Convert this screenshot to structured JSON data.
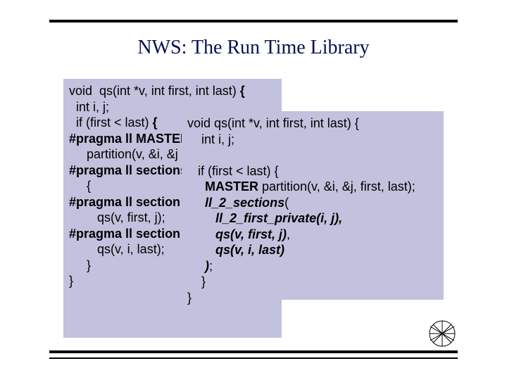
{
  "title": "NWS: The Run Time Library",
  "code_left": {
    "l1a": "void  qs(int *v, int first, int last) ",
    "l1b": "{",
    "l2": "  int i, j;",
    "l3a": "  if (first < last) ",
    "l3b": "{",
    "l4": "#pragma ll MASTER",
    "l5": "     partition(v, &i, &j first, last);",
    "l6": "#pragma ll sections firstprivate(i,j)",
    "l7": "     {",
    "l8": "#pragma ll section",
    "l9": "        qs(v, first, j);",
    "l10": "#pragma ll section",
    "l11": "        qs(v, i, last);",
    "l12": "     }",
    "l13": "}"
  },
  "code_right": {
    "l1": "void qs(int *v, int first, int last) {",
    "l2": "    int i, j;",
    "blank": "",
    "l3": "   if (first < last) {",
    "l4a": "     ",
    "l4b": "MASTER",
    "l4c": " partition(v, &i, &j, first, last);",
    "l5a": "     ",
    "l5b": "ll_2_sections",
    "l5c": "(",
    "l6a": "        ",
    "l6b": "ll_2_first_private",
    "l6c": "(i, j),",
    "l7a": "        qs(v, first, j)",
    "l7b": ",",
    "l8a": "        qs(v, i, last)",
    "l9a": "     )",
    "l9b": ";",
    "l10": "    }",
    "l11": "}"
  }
}
